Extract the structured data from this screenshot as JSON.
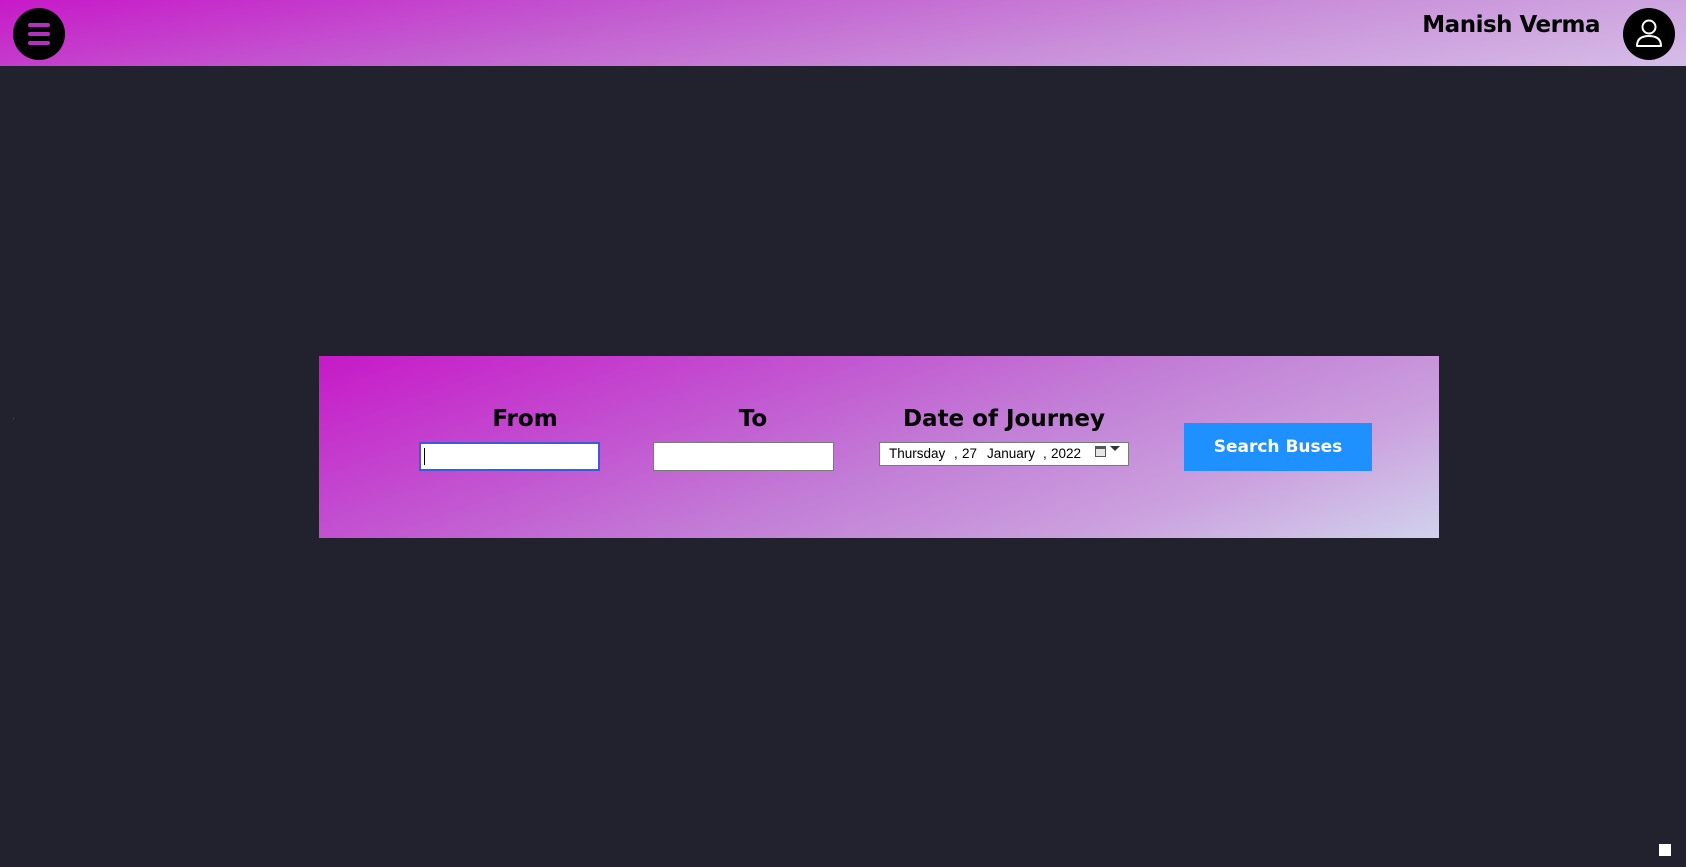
{
  "header": {
    "user_name": "Manish Verma",
    "menu_icon": "hamburger-menu-icon",
    "avatar_icon": "user-icon"
  },
  "search_form": {
    "from_label": "From",
    "from_value": "",
    "to_label": "To",
    "to_value": "",
    "date_label": "Date of Journey",
    "date": {
      "weekday": "Thursday",
      "day": "27",
      "month": "January",
      "year": "2022"
    },
    "search_button": "Search Buses"
  },
  "colors": {
    "background": "#22212e",
    "gradient_start": "#c719c8",
    "gradient_end": "#d0d2ec",
    "button": "#1e90ff",
    "menu_bar": "#b52fc0"
  }
}
